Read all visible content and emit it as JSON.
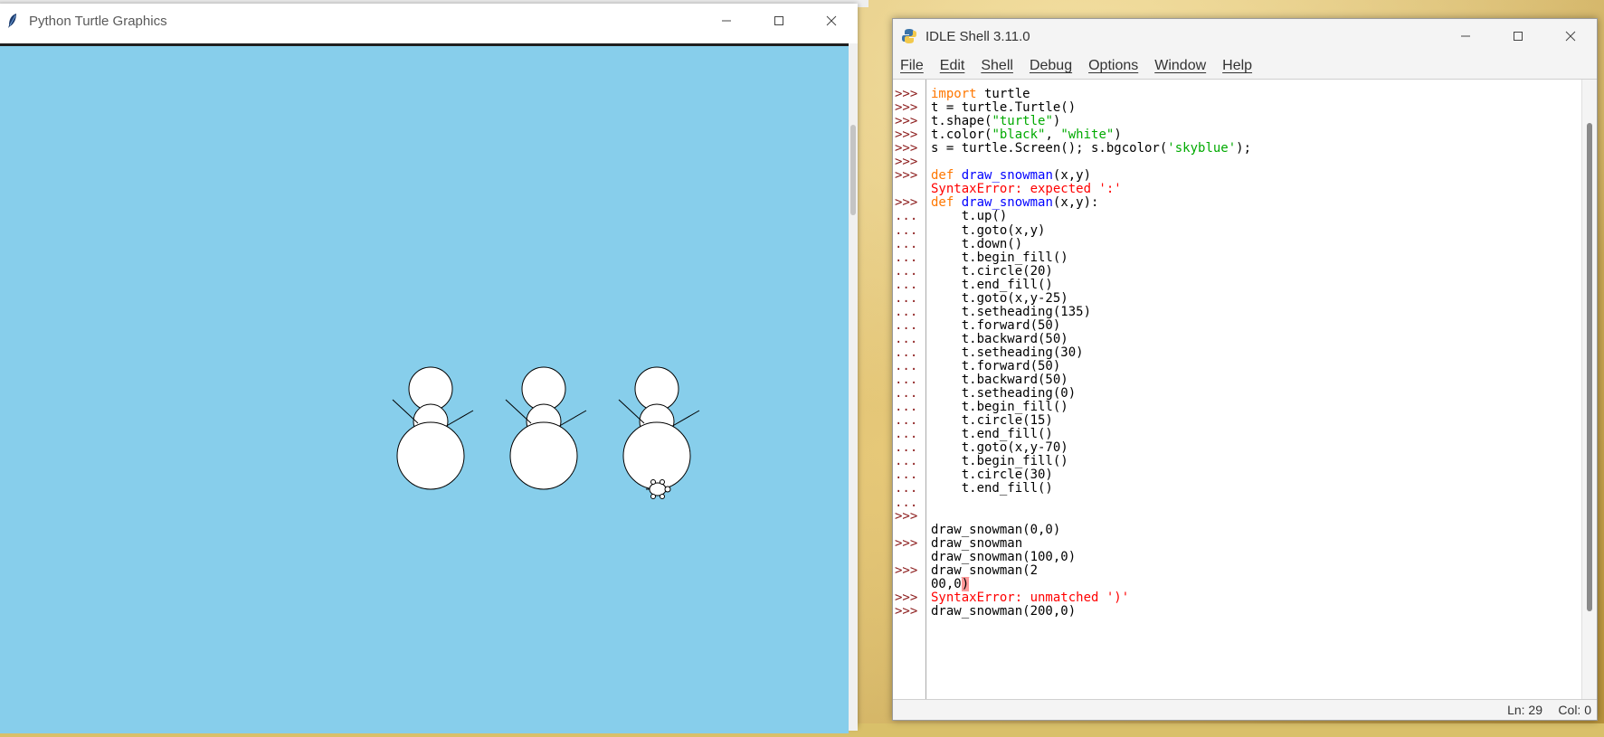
{
  "turtle_window": {
    "title": "Python Turtle Graphics",
    "canvas_bg": "#87ceeb",
    "icon": "feather-icon"
  },
  "idle_window": {
    "title": "IDLE Shell 3.11.0",
    "icon": "python-icon",
    "menu": [
      "File",
      "Edit",
      "Shell",
      "Debug",
      "Options",
      "Window",
      "Help"
    ],
    "status": {
      "ln": "Ln: 29",
      "col": "Col: 0"
    },
    "prompts": [
      ">>>",
      ">>>",
      ">>>",
      ">>>",
      ">>>",
      ">>>",
      ">>>",
      "",
      ">>>",
      "...",
      "...",
      "...",
      "...",
      "...",
      "...",
      "...",
      "...",
      "...",
      "...",
      "...",
      "...",
      "...",
      "...",
      "...",
      "...",
      "...",
      "...",
      "...",
      "...",
      "...",
      "...",
      ">>>",
      "",
      ">>>",
      "",
      ">>>",
      "",
      ">>>",
      ">>>"
    ],
    "lines": [
      [
        {
          "t": "import",
          "c": "kw"
        },
        {
          "t": " turtle",
          "c": "txt"
        }
      ],
      [
        {
          "t": "t = turtle.Turtle()",
          "c": "txt"
        }
      ],
      [
        {
          "t": "t.shape(",
          "c": "txt"
        },
        {
          "t": "\"turtle\"",
          "c": "str"
        },
        {
          "t": ")",
          "c": "txt"
        }
      ],
      [
        {
          "t": "t.color(",
          "c": "txt"
        },
        {
          "t": "\"black\"",
          "c": "str"
        },
        {
          "t": ", ",
          "c": "txt"
        },
        {
          "t": "\"white\"",
          "c": "str"
        },
        {
          "t": ")",
          "c": "txt"
        }
      ],
      [
        {
          "t": "s = turtle.Screen(); s.bgcolor(",
          "c": "txt"
        },
        {
          "t": "'skyblue'",
          "c": "str"
        },
        {
          "t": ");",
          "c": "txt"
        }
      ],
      [
        {
          "t": "",
          "c": "txt"
        }
      ],
      [
        {
          "t": "def",
          "c": "kw"
        },
        {
          "t": " ",
          "c": "txt"
        },
        {
          "t": "draw_snowman",
          "c": "fn"
        },
        {
          "t": "(x,y)",
          "c": "txt"
        }
      ],
      [
        {
          "t": "SyntaxError: expected ':'",
          "c": "err"
        }
      ],
      [
        {
          "t": "def",
          "c": "kw"
        },
        {
          "t": " ",
          "c": "txt"
        },
        {
          "t": "draw_snowman",
          "c": "fn"
        },
        {
          "t": "(x,y):",
          "c": "txt"
        }
      ],
      [
        {
          "t": "    t.up()",
          "c": "txt"
        }
      ],
      [
        {
          "t": "    t.goto(x,y)",
          "c": "txt"
        }
      ],
      [
        {
          "t": "    t.down()",
          "c": "txt"
        }
      ],
      [
        {
          "t": "    t.begin_fill()",
          "c": "txt"
        }
      ],
      [
        {
          "t": "    t.circle(20)",
          "c": "txt"
        }
      ],
      [
        {
          "t": "    t.end_fill()",
          "c": "txt"
        }
      ],
      [
        {
          "t": "    t.goto(x,y-25)",
          "c": "txt"
        }
      ],
      [
        {
          "t": "    t.setheading(135)",
          "c": "txt"
        }
      ],
      [
        {
          "t": "    t.forward(50)",
          "c": "txt"
        }
      ],
      [
        {
          "t": "    t.backward(50)",
          "c": "txt"
        }
      ],
      [
        {
          "t": "    t.setheading(30)",
          "c": "txt"
        }
      ],
      [
        {
          "t": "    t.forward(50)",
          "c": "txt"
        }
      ],
      [
        {
          "t": "    t.backward(50)",
          "c": "txt"
        }
      ],
      [
        {
          "t": "    t.setheading(0)",
          "c": "txt"
        }
      ],
      [
        {
          "t": "    t.begin_fill()",
          "c": "txt"
        }
      ],
      [
        {
          "t": "    t.circle(15)",
          "c": "txt"
        }
      ],
      [
        {
          "t": "    t.end_fill()",
          "c": "txt"
        }
      ],
      [
        {
          "t": "    t.goto(x,y-70)",
          "c": "txt"
        }
      ],
      [
        {
          "t": "    t.begin_fill()",
          "c": "txt"
        }
      ],
      [
        {
          "t": "    t.circle(30)",
          "c": "txt"
        }
      ],
      [
        {
          "t": "    t.end_fill()",
          "c": "txt"
        }
      ],
      [
        {
          "t": "",
          "c": "txt"
        }
      ],
      [
        {
          "t": "",
          "c": "txt"
        }
      ],
      [
        {
          "t": "draw_snowman(0,0)",
          "c": "txt"
        }
      ],
      [
        {
          "t": "draw_snowman",
          "c": "txt"
        }
      ],
      [
        {
          "t": "draw_snowman(100,0)",
          "c": "txt"
        }
      ],
      [
        {
          "t": "draw_snowman(2",
          "c": "txt"
        }
      ],
      [
        {
          "t": "00,0",
          "c": "txt"
        },
        {
          "t": ")",
          "c": "hl"
        }
      ],
      [
        {
          "t": "SyntaxError: unmatched ')'",
          "c": "err"
        }
      ],
      [
        {
          "t": "draw_snowman(200,0)",
          "c": "txt"
        }
      ],
      [
        {
          "t": "",
          "c": "txt"
        }
      ]
    ],
    "prompt_rows": [
      ">>>",
      ">>>",
      ">>>",
      ">>>",
      ">>>",
      ">>>",
      ">>>",
      "",
      ">>>",
      "...",
      "...",
      "...",
      "...",
      "...",
      "...",
      "...",
      "...",
      "...",
      "...",
      "...",
      "...",
      "...",
      "...",
      "...",
      "...",
      "...",
      "...",
      "...",
      "...",
      "...",
      "...",
      ">>>",
      "",
      ">>>",
      "",
      ">>>",
      "",
      ">>>",
      ">>>"
    ]
  }
}
